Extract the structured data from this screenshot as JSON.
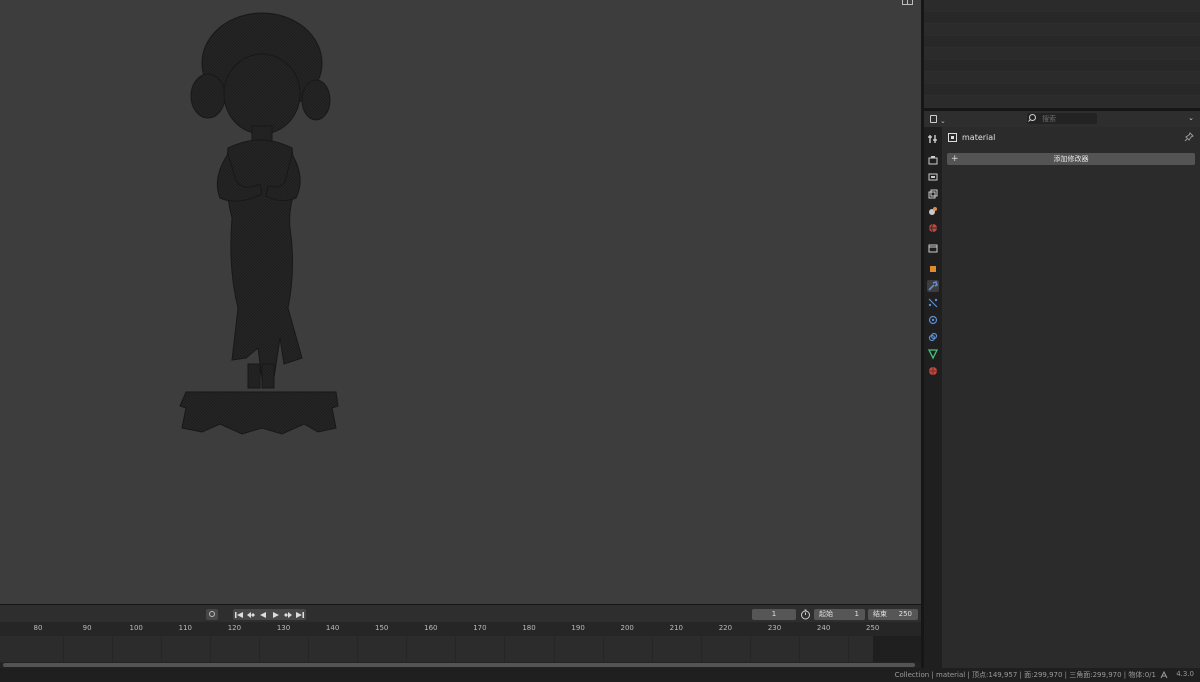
{
  "properties": {
    "search_placeholder": "搜索",
    "object_name": "material",
    "add_modifier_label": "添加修改器",
    "tabs": [
      "tool-icon",
      "render-icon",
      "output-icon",
      "view-layer-icon",
      "scene-icon",
      "world-icon",
      "collection-icon",
      "object-icon",
      "modifier-icon",
      "particles-icon",
      "physics-icon",
      "constraints-icon",
      "data-icon",
      "material-icon"
    ],
    "active_tab": "modifier-icon"
  },
  "timeline": {
    "current_frame": "1",
    "start_label": "起始",
    "start_value": "1",
    "end_label": "结束",
    "end_value": "250",
    "ruler_ticks": [
      "80",
      "90",
      "100",
      "110",
      "120",
      "130",
      "140",
      "150",
      "160",
      "170",
      "180",
      "190",
      "200",
      "210",
      "220",
      "230",
      "240",
      "250"
    ]
  },
  "statusbar": {
    "text": "Collection | material | 顶点:149,957 | 面:299,970 | 三角面:299,970 | 物体:0/1",
    "version": "4.3.0"
  },
  "colors": {
    "viewport_bg": "#3d3d3d",
    "panel_bg": "#2b2b2b",
    "button_bg": "#545454",
    "modifier_active": "#5b8fd6"
  }
}
